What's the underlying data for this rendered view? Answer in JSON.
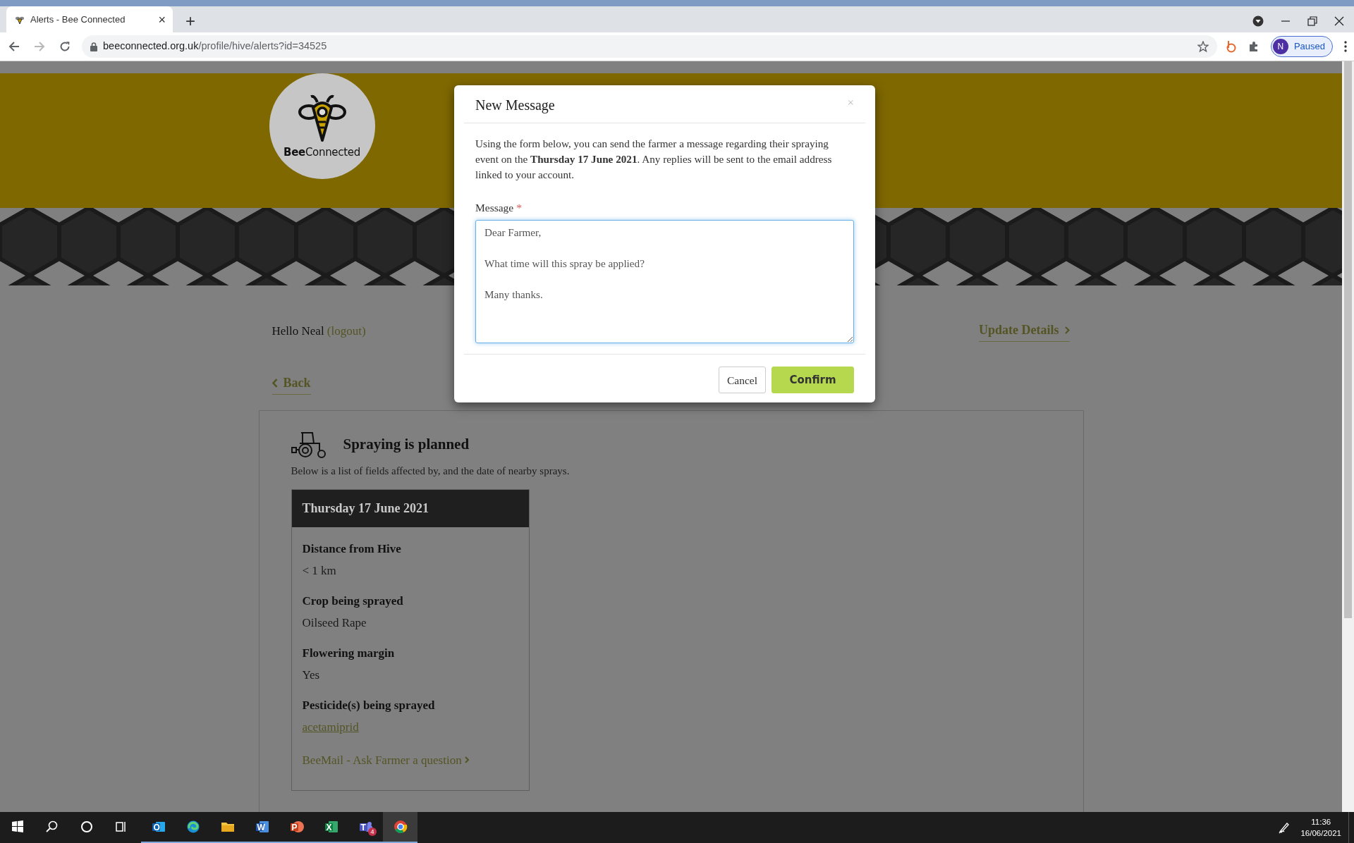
{
  "browser": {
    "tab": {
      "title": "Alerts - Bee Connected",
      "close": "×"
    },
    "new_tab": "+",
    "address": {
      "host": "beeconnected.org.uk",
      "path": "/profile/hive/alerts?id=34525"
    },
    "profile": {
      "initial": "N",
      "status": "Paused"
    }
  },
  "header": {
    "logo": "**Bee**Connected"
  },
  "account": {
    "greeting": "Hello Neal",
    "logout": "(logout)",
    "update_details": "Update Details"
  },
  "back": "Back",
  "alert": {
    "title": "Spraying is planned",
    "subtitle": "Below is a list of fields affected by, and the date of nearby sprays.",
    "event": {
      "date": "Thursday 17 June 2021",
      "fields": [
        {
          "label": "Distance from Hive",
          "value": "< 1 km",
          "kind": "text"
        },
        {
          "label": "Crop being sprayed",
          "value": "Oilseed Rape",
          "kind": "text"
        },
        {
          "label": "Flowering margin",
          "value": "Yes",
          "kind": "text"
        },
        {
          "label": "Pesticide(s) being sprayed",
          "value": "acetamiprid",
          "kind": "link"
        }
      ],
      "action": "BeeMail - Ask Farmer a question"
    }
  },
  "modal": {
    "title": "New Message",
    "close": "×",
    "intro": "Using the form below, you can send the farmer a message regarding their spraying event on the **Thursday 17 June 2021**. Any replies will be sent to the email address linked to your account.",
    "field": {
      "label": "Message",
      "required_mark": "*",
      "value": "Dear Farmer,\n\nWhat time will this spray be applied?\n\nMany thanks."
    },
    "buttons": [
      {
        "label": "Cancel",
        "kind": "secondary"
      },
      {
        "label": "Confirm",
        "kind": "primary"
      }
    ]
  },
  "taskbar": {
    "apps": [
      {
        "kind": "start",
        "running": false,
        "selected": false
      },
      {
        "kind": "search",
        "running": false,
        "selected": false
      },
      {
        "kind": "cortana",
        "running": false,
        "selected": false
      },
      {
        "kind": "task-view",
        "running": false,
        "selected": false
      },
      {
        "kind": "outlook",
        "letter": "O",
        "running": true,
        "selected": false
      },
      {
        "kind": "edge",
        "running": true,
        "selected": false
      },
      {
        "kind": "explorer",
        "running": true,
        "selected": false
      },
      {
        "kind": "word",
        "letter": "W",
        "running": true,
        "selected": false
      },
      {
        "kind": "powerpoint",
        "letter": "P",
        "running": true,
        "selected": false
      },
      {
        "kind": "excel",
        "letter": "X",
        "running": true,
        "selected": false
      },
      {
        "kind": "teams",
        "letter": "T",
        "badge": "4",
        "running": true,
        "selected": false
      },
      {
        "kind": "chrome",
        "running": true,
        "selected": true
      }
    ],
    "time": "11:36",
    "date": "16/06/2021"
  }
}
